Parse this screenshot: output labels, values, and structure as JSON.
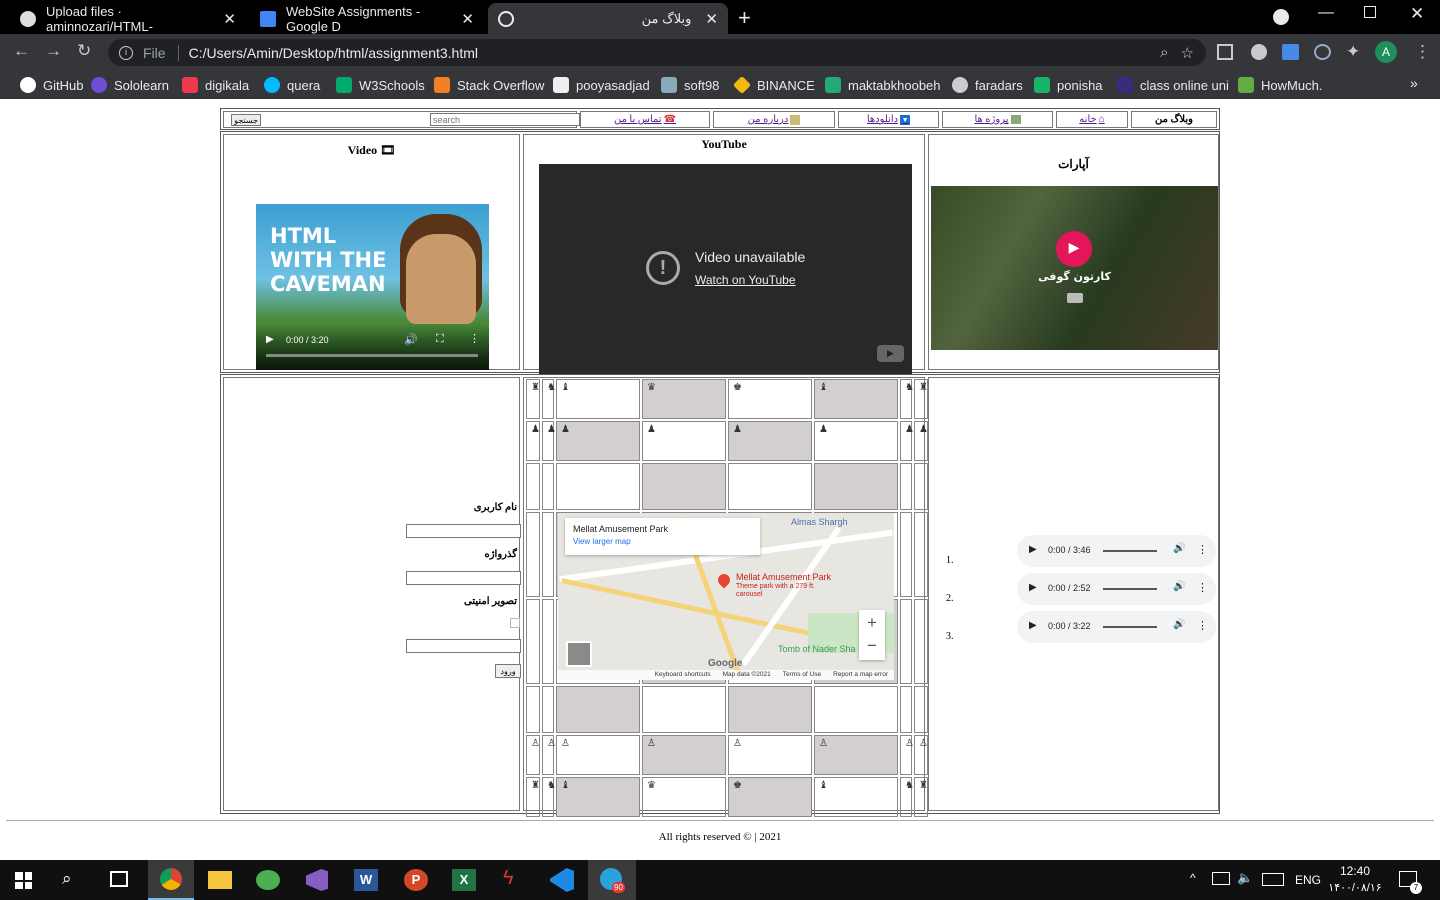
{
  "browser": {
    "tabs": [
      {
        "title": "Upload files · aminnozari/HTML-"
      },
      {
        "title": "WebSite Assignments - Google D"
      },
      {
        "title": "وبلاگ من"
      }
    ],
    "address": {
      "scheme": "File",
      "url": "C:/Users/Amin/Desktop/html/assignment3.html"
    },
    "profile_initial": "A",
    "bookmarks": [
      "GitHub",
      "Sololearn",
      "digikala",
      "quera",
      "W3Schools",
      "Stack Overflow",
      "pooyasadjad",
      "soft98",
      "BINANCE",
      "maktabkhoobeh",
      "faradars",
      "ponisha",
      "class online uni",
      "HowMuch."
    ]
  },
  "nav": {
    "title": "وبلاگ من",
    "home": "خانه",
    "projects": "پروژه ها",
    "downloads": "دانلودها",
    "about": "درباره من",
    "contact": "تماس با من",
    "search_placeholder": "search",
    "search_button": "جستجو"
  },
  "media": {
    "aparat_title": "آپارات",
    "aparat_video_title": "کارتون گوفی",
    "youtube_title": "YouTube",
    "youtube_error": "Video unavailable",
    "youtube_link": "Watch on YouTube",
    "video_title": "Video",
    "video_thumb_text": "HTML WITH THE CAVEMAN",
    "video_time": "0:00 / 3:20"
  },
  "audio": {
    "items": [
      {
        "number": "1.",
        "time": "0:00 / 3:46"
      },
      {
        "number": "2.",
        "time": "0:00 / 2:52"
      },
      {
        "number": "3.",
        "time": "0:00 / 3:22"
      }
    ]
  },
  "map": {
    "place": "Mellat Amusement Park",
    "larger": "View larger map",
    "pin_label": "Mellat Amusement Park",
    "pin_sub": "Theme park with a 279 ft. carousel",
    "almas": "Almas Shargh",
    "tomb": "Tomb of Nader Sha",
    "footer": [
      "Keyboard shortcuts",
      "Map data ©2021",
      "Terms of Use",
      "Report a map error"
    ]
  },
  "login": {
    "username_label": "نام کاربری",
    "password_label": "گذرواژه",
    "captcha_label": "تصویر امنیتی",
    "submit": "ورود"
  },
  "footer": {
    "text": "All rights reserved © | 2021"
  },
  "taskbar": {
    "time": "12:40",
    "date": "۱۴۰۰/۰۸/۱۶",
    "lang": "ENG",
    "notifications": "7",
    "telegram_badge": "90"
  }
}
